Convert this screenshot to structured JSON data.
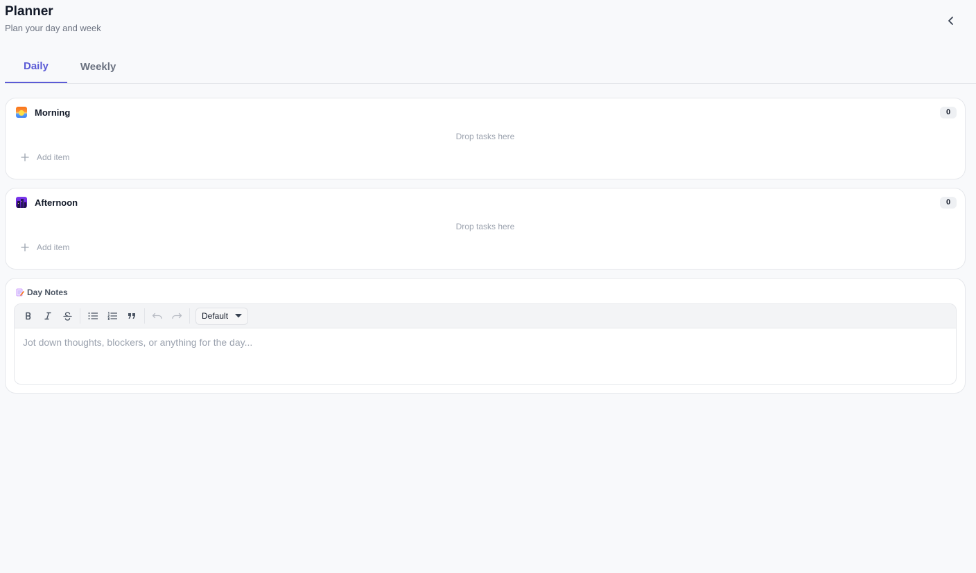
{
  "header": {
    "title": "Planner",
    "subtitle": "Plan your day and week",
    "collapse_icon": "chevron-left-icon"
  },
  "tabs": [
    {
      "label": "Daily",
      "active": true
    },
    {
      "label": "Weekly",
      "active": false
    }
  ],
  "sections": [
    {
      "name": "Morning",
      "icon": "sunrise-icon",
      "count": "0",
      "drop_text": "Drop tasks here",
      "add_label": "Add item"
    },
    {
      "name": "Afternoon",
      "icon": "city-dusk-icon",
      "count": "0",
      "drop_text": "Drop tasks here",
      "add_label": "Add item"
    }
  ],
  "notes": {
    "icon": "memo-icon",
    "title": "Day Notes",
    "style_select": "Default",
    "placeholder": "Jot down thoughts, blockers, or anything for the day..."
  },
  "colors": {
    "accent": "#5b5bd6",
    "background": "#f8f9fb",
    "muted_text": "#9ca3af"
  }
}
